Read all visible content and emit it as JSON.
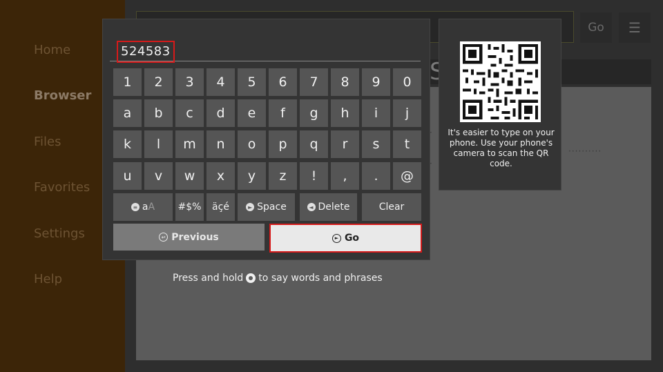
{
  "sidebar": {
    "items": [
      {
        "label": "Home"
      },
      {
        "label": "Browser"
      },
      {
        "label": "Files"
      },
      {
        "label": "Favorites"
      },
      {
        "label": "Settings"
      },
      {
        "label": "Help"
      }
    ],
    "active": "Browser"
  },
  "browser_bar": {
    "go_label": "Go",
    "menu_icon": "menu-icon"
  },
  "page": {
    "partial_text": "S",
    "voice_hint_before": "Press and hold",
    "voice_hint_after": "to say words and phrases"
  },
  "keyboard": {
    "input_value": "524583",
    "rows": [
      [
        "1",
        "2",
        "3",
        "4",
        "5",
        "6",
        "7",
        "8",
        "9",
        "0"
      ],
      [
        "a",
        "b",
        "c",
        "d",
        "e",
        "f",
        "g",
        "h",
        "i",
        "j"
      ],
      [
        "k",
        "l",
        "m",
        "n",
        "o",
        "p",
        "q",
        "r",
        "s",
        "t"
      ],
      [
        "u",
        "v",
        "w",
        "x",
        "y",
        "z",
        "!",
        ",",
        ".",
        "@"
      ]
    ],
    "function_keys": {
      "case_label": "a",
      "case_label_dim": "A",
      "symbols_label": "#$%",
      "accents_label": "äçé",
      "space_label": "Space",
      "delete_label": "Delete",
      "clear_label": "Clear"
    },
    "previous_label": "Previous",
    "go_label": "Go"
  },
  "qr": {
    "text": "It's easier to type on your phone. Use your phone's camera to scan the QR code."
  },
  "colors": {
    "sidebar_bg": "#3c2508",
    "focus_border": "#d71a1a",
    "key_bg": "#555555",
    "panel_bg": "#343434"
  }
}
